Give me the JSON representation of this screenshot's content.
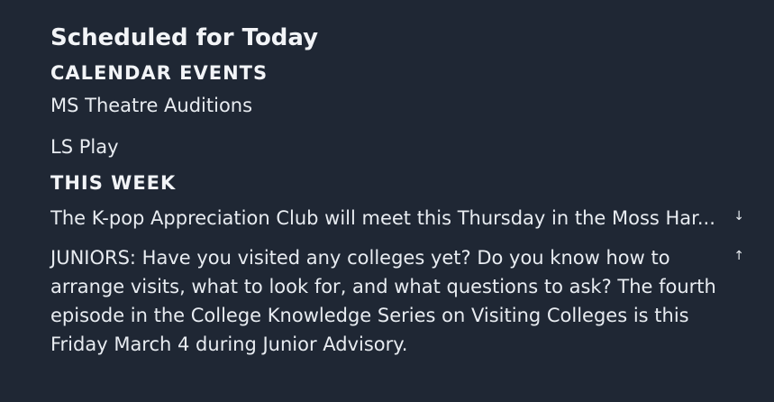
{
  "header": {
    "title": "Scheduled for Today"
  },
  "calendar": {
    "heading": "CALENDAR EVENTS",
    "events": [
      {
        "label": "MS Theatre Auditions"
      },
      {
        "label": "LS Play"
      }
    ]
  },
  "this_week": {
    "heading": "THIS WEEK",
    "items": [
      {
        "text": "The K-pop Appreciation Club will meet this Thursday in the Moss Har...",
        "toggle_icon": "arrow-down-icon",
        "toggle_glyph": "↓"
      },
      {
        "text": "JUNIORS: Have you visited any colleges yet? Do you know how to arrange visits, what to look for, and what questions to ask? The fourth episode in the College Knowledge Series on Visiting Colleges is this Friday March 4 during Junior Advisory.",
        "toggle_icon": "arrow-up-icon",
        "toggle_glyph": "↑"
      }
    ]
  }
}
